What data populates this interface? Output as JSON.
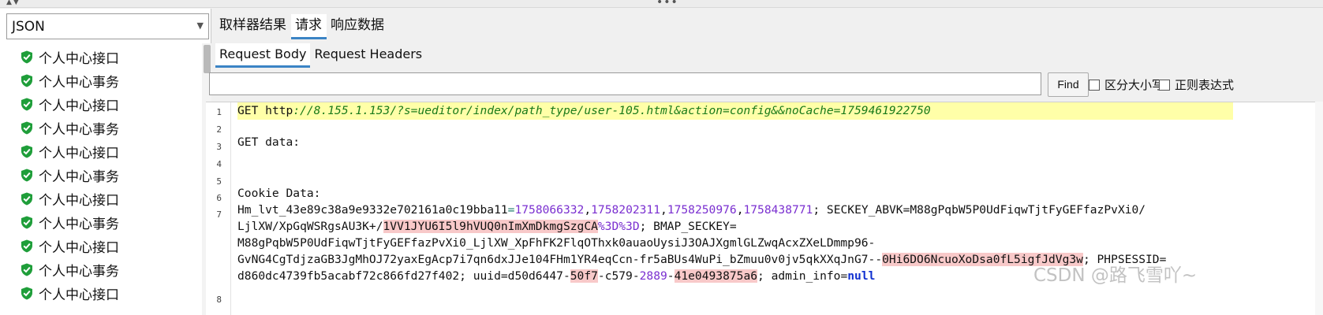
{
  "left_panel": {
    "renderer": "JSON",
    "tree_items": [
      "个人中心接口",
      "个人中心事务",
      "个人中心接口",
      "个人中心事务",
      "个人中心接口",
      "个人中心事务",
      "个人中心接口",
      "个人中心事务",
      "个人中心接口",
      "个人中心事务",
      "个人中心接口"
    ]
  },
  "tabs": [
    "取样器结果",
    "请求",
    "响应数据"
  ],
  "active_tab": "请求",
  "subtabs": [
    "Request Body",
    "Request Headers"
  ],
  "active_subtab": "Request Body",
  "search": {
    "value": "",
    "find_label": "Find",
    "case_label": "区分大小写",
    "regex_label": "正则表达式"
  },
  "editor": {
    "line_numbers": [
      "1",
      "2",
      "3",
      "4",
      "5",
      "6",
      "7",
      "8"
    ],
    "line1_method": "GET ",
    "line1_scheme": "http",
    "line1_url": "://8.155.1.153/?s=ueditor/index/path_type/user-105.html&action=config&&noCache=1759461922750",
    "line3": "GET data:",
    "line6": "Cookie Data:",
    "l7a_1": "Hm_lvt_43e89c38a9e9332e702161a0c19bba11",
    "l7a_eq": "=",
    "l7a_n1": "1758066332",
    "l7a_c1": ",",
    "l7a_n2": "1758202311",
    "l7a_c2": ",",
    "l7a_n3": "1758250976",
    "l7a_c3": ",",
    "l7a_n4": "1758438771",
    "l7a_rest": "; SECKEY_ABVK=M88gPqbW5P0UdFiqwTjtFyGEFfazPvXi0/",
    "l7b_1": "LjlXW/XpGqWSRgsAU3K+/",
    "l7b_pink": "1VV1JYU6I5l9hVUQ0nImXmDkmgSzgCA",
    "l7b_enc": "%3D%3D",
    "l7b_rest": "; BMAP_SECKEY=",
    "l7c": "M88gPqbW5P0UdFiqwTjtFyGEFfazPvXi0_LjlXW_XpFhFK2FlqOThxk0auaoUysiJ3OAJXgmlGLZwqAcxZXeLDmmp96-",
    "l7d_1": "GvNG4CgTdjzaGB3JgMhOJ72yaxEgAcp7i7qn6dxJJe104FHm1YR4eqCcn-fr5aBUs4WuPi_bZmuu0v0jv5qkXXqJnG7--",
    "l7d_pink": "0Hi6DO6NcuoXoDsa0fL5igfJdVg3w",
    "l7d_rest": "; PHPSESSID=",
    "l7e_1": "d860dc4739fb5acabf72c866fd27f402; uuid=d50d6447-",
    "l7e_p1": "50f7",
    "l7e_2": "-c579-",
    "l7e_n1": "2889",
    "l7e_3": "-",
    "l7e_p2": "41e0493875a6",
    "l7e_4": "; admin_info=",
    "l7e_null": "null"
  },
  "watermark": "CSDN @路飞雪吖~"
}
